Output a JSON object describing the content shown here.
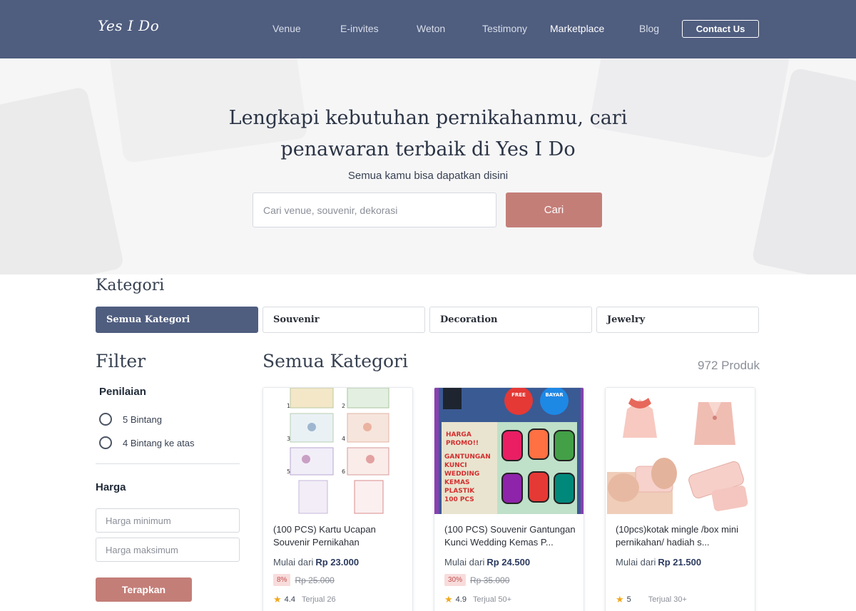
{
  "nav": {
    "logo": "Yes I Do",
    "links": [
      {
        "label": "Venue"
      },
      {
        "label": "E-invites"
      },
      {
        "label": "Weton"
      },
      {
        "label": "Testimony"
      },
      {
        "label": "Marketplace"
      },
      {
        "label": "Blog"
      }
    ],
    "contact_label": "Contact Us"
  },
  "hero": {
    "title_line1": "Lengkapi kebutuhan pernikahanmu, cari",
    "title_line2": "penawaran terbaik di Yes I Do",
    "subtitle": "Semua kamu bisa dapatkan disini",
    "search_placeholder": "Cari venue, souvenir, dekorasi",
    "search_button": "Cari"
  },
  "kategori": {
    "title": "Kategori",
    "tabs": [
      {
        "label": "Semua Kategori"
      },
      {
        "label": "Souvenir"
      },
      {
        "label": "Decoration"
      },
      {
        "label": "Jewelry"
      }
    ]
  },
  "filter": {
    "title": "Filter",
    "rating_title": "Penilaian",
    "rating_options": [
      "5 Bintang",
      "4 Bintang ke atas"
    ],
    "price_title": "Harga",
    "min_placeholder": "Harga minimum",
    "max_placeholder": "Harga maksimum",
    "apply_label": "Terapkan"
  },
  "products": {
    "section_title": "Semua Kategori",
    "count": "972 Produk",
    "price_prefix": "Mulai dari",
    "items": [
      {
        "name_line1": "(100 PCS) Kartu Ucapan",
        "name_line2": "Souvenir Pernikahan",
        "price": "Rp 23.000",
        "discount": "8%",
        "old_price": "Rp 25.000",
        "rating": "4.4",
        "sold": "Terjual 26"
      },
      {
        "name_line1": "(100 PCS) Souvenir Gantungan",
        "name_line2": "Kunci Wedding Kemas P...",
        "price": "Rp 24.500",
        "discount": "30%",
        "old_price": "Rp 35.000",
        "rating": "4.9",
        "sold": "Terjual 50+",
        "image_text": {
          "free": "FREE",
          "bayar": "BAYAR",
          "promo_lines": [
            "HARGA",
            "PROMO!!",
            "GANTUNGAN",
            "KUNCI",
            "WEDDING",
            "KEMAS",
            "PLASTIK",
            "100 PCS"
          ]
        }
      },
      {
        "name_line1": "(10pcs)kotak mingle /box mini",
        "name_line2": "pernikahan/ hadiah s...",
        "price": "Rp 21.500",
        "rating": "5",
        "sold": "Terjual 30+"
      }
    ]
  },
  "colors": {
    "nav_bg": "#4f5d7f",
    "accent": "#c47e78",
    "star": "#f2a81d"
  }
}
